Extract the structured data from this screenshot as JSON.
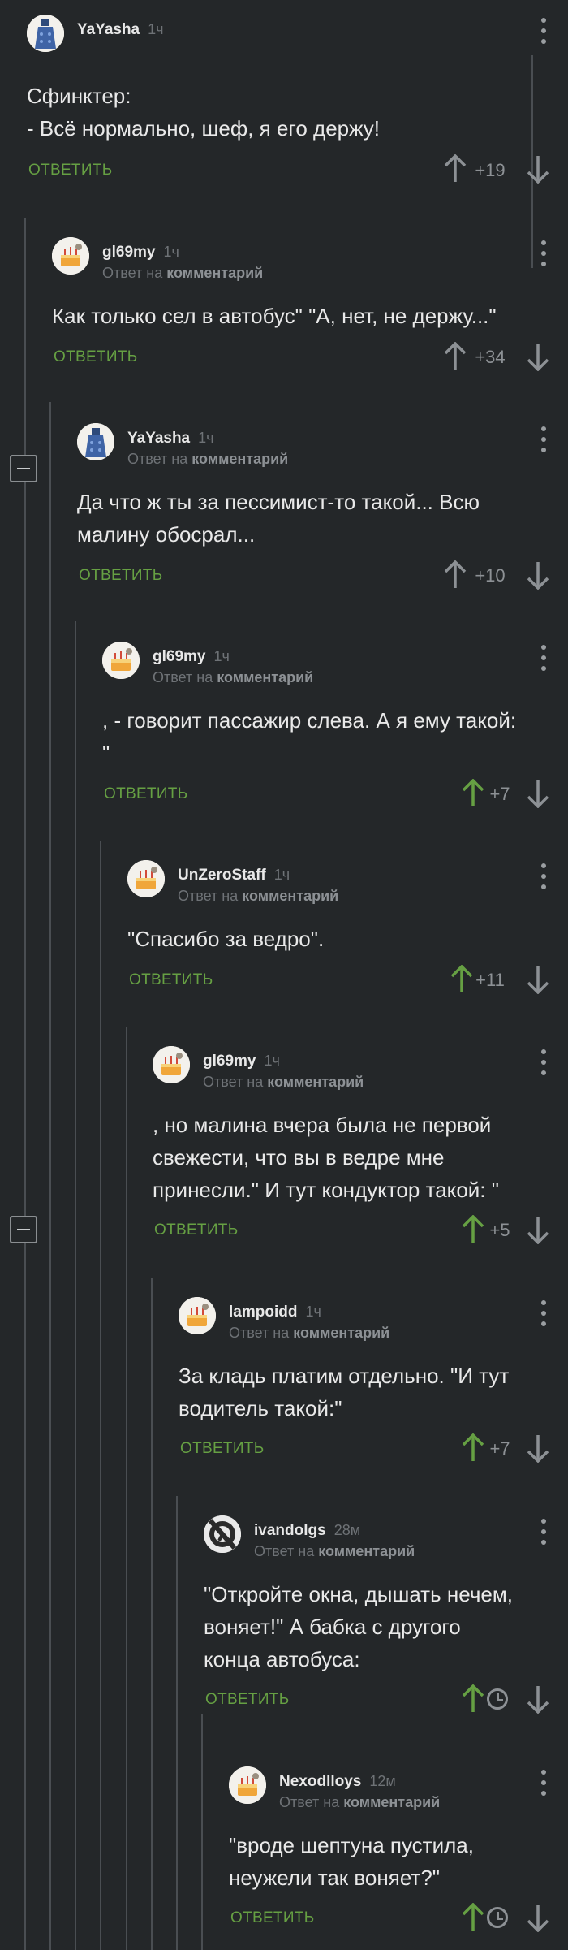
{
  "labels": {
    "reply": "ОТВЕТИТЬ",
    "reply_to_prefix": "Ответ на",
    "reply_to_target": "комментарий"
  },
  "colors": {
    "background": "#242729",
    "accent_green": "#66a043",
    "muted": "#8d9195",
    "thread_line": "#4a4e52"
  },
  "comments": [
    {
      "author": "YaYasha",
      "time": "1ч",
      "avatar": "dalek-avatar",
      "text": "Сфинктер:\n- Всё нормально, шеф, я его держу!",
      "rating": "+19",
      "voted_up": false,
      "pending": false
    },
    {
      "author": "gl69my",
      "time": "1ч",
      "avatar": "cake-avatar",
      "text": "Как только сел в автобус\" \"А, нет, не держу...\"",
      "rating": "+34",
      "voted_up": false,
      "pending": false
    },
    {
      "author": "YaYasha",
      "time": "1ч",
      "avatar": "dalek-avatar",
      "text": "Да что ж ты за пессимист-то такой... Всю\nмалину обосрал...",
      "rating": "+10",
      "voted_up": false,
      "pending": false
    },
    {
      "author": "gl69my",
      "time": "1ч",
      "avatar": "cake-avatar",
      "text": ", - говорит пассажир слева. А я ему такой:\n\"",
      "rating": "+7",
      "voted_up": true,
      "pending": false
    },
    {
      "author": "UnZeroStaff",
      "time": "1ч",
      "avatar": "cake-avatar",
      "text": "\"Спасибо за ведро\".",
      "rating": "+11",
      "voted_up": true,
      "pending": false
    },
    {
      "author": "gl69my",
      "time": "1ч",
      "avatar": "cake-avatar",
      "text": ", но малина вчера была не первой\nсвежести, что вы в ведре мне\nпринесли.\" И тут кондуктор такой: \"",
      "rating": "+5",
      "voted_up": true,
      "pending": false
    },
    {
      "author": "lampoidd",
      "time": "1ч",
      "avatar": "cake-avatar",
      "text": "За кладь платим отдельно. \"И тут\nводитель такой:\"",
      "rating": "+7",
      "voted_up": true,
      "pending": false
    },
    {
      "author": "ivandolgs",
      "time": "28м",
      "avatar": "half-life-avatar",
      "text": "\"Откройте окна, дышать нечем,\nвоняет!\" А бабка с другого\nконца автобуса:",
      "rating": "",
      "voted_up": true,
      "pending": true
    },
    {
      "author": "Nexodlloys",
      "time": "12м",
      "avatar": "cake-avatar",
      "text": "\"вроде шептуна пустила,\nнеужели так воняет?\"",
      "rating": "",
      "voted_up": true,
      "pending": true
    }
  ]
}
